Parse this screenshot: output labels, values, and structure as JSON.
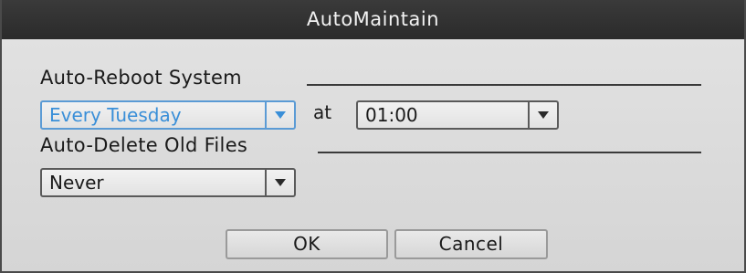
{
  "window": {
    "title": "AutoMaintain"
  },
  "reboot": {
    "section_label": "Auto-Reboot System",
    "day_value": "Every Tuesday",
    "at_label": "at",
    "time_value": "01:00"
  },
  "delete": {
    "section_label": "Auto-Delete Old Files",
    "value": "Never"
  },
  "buttons": {
    "ok": "OK",
    "cancel": "Cancel"
  },
  "colors": {
    "focus_accent": "#5b9bd5",
    "title_bar": "#2f2f2f"
  },
  "icons": {
    "dropdown": "chevron-down-icon"
  }
}
